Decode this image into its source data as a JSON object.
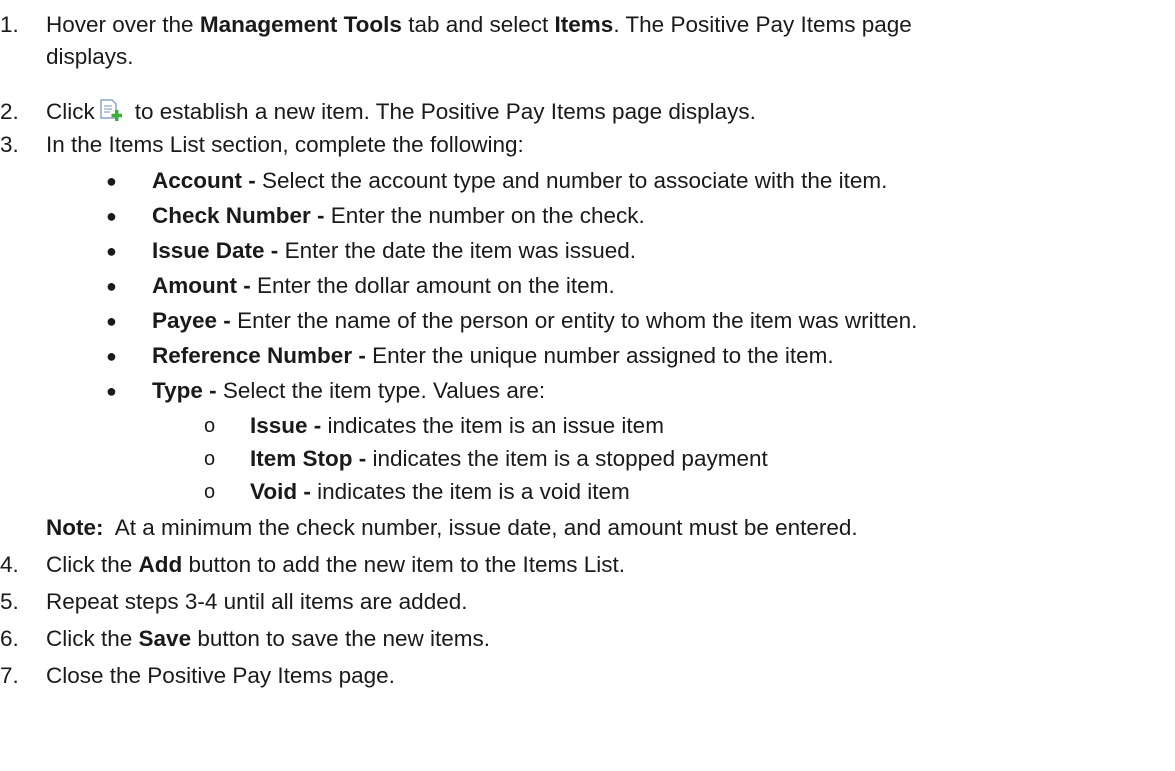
{
  "step1": {
    "num": "1.",
    "pre": "Hover over the ",
    "b1": "Management Tools",
    "mid": " tab and select ",
    "b2": "Items",
    "post": ". The Positive Pay Items page",
    "cont": "displays."
  },
  "step2": {
    "num": "2.",
    "pre": "Click",
    "icon": "add-item-icon",
    "post": "to establish a new item. The Positive Pay Items page displays."
  },
  "step3": {
    "num": "3.",
    "text": "In the Items List section, complete the following:",
    "bullets": [
      {
        "label": "Account -",
        "text": " Select the account type and number to associate with the item."
      },
      {
        "label": "Check Number -",
        "text": " Enter the number on the check."
      },
      {
        "label": "Issue Date -",
        "text": " Enter the date the item was issued."
      },
      {
        "label": "Amount -",
        "text": " Enter the dollar amount on the item."
      },
      {
        "label": "Payee -",
        "text": " Enter the name of the person or entity to whom the item was written."
      },
      {
        "label": "Reference Number -",
        "text": " Enter the unique number assigned to the item."
      },
      {
        "label": "Type -",
        "text": " Select the item type. Values are:"
      }
    ],
    "bullet_glyph": "●",
    "sub_glyph": "o",
    "subitems": [
      {
        "label": "Issue -",
        "text": " indicates the item is an issue item"
      },
      {
        "label": "Item Stop -",
        "text": " indicates the item is a stopped payment"
      },
      {
        "label": "Void -",
        "text": " indicates the item is a void item"
      }
    ],
    "note_label": "Note:",
    "note_text": "  At a minimum the check number, issue date, and amount must be entered."
  },
  "step4": {
    "num": "4.",
    "pre": "Click the ",
    "b": "Add",
    "post": " button to add the new item to the Items List."
  },
  "step5": {
    "num": "5.",
    "text": "Repeat steps 3-4 until all items are added."
  },
  "step6": {
    "num": "6.",
    "pre": "Click the ",
    "b": "Save",
    "post": " button to save the new items."
  },
  "step7": {
    "num": "7.",
    "text": "Close the Positive Pay Items page."
  },
  "colors": {
    "icon_page": "#8aa4c8",
    "icon_plus": "#3cae3c"
  }
}
